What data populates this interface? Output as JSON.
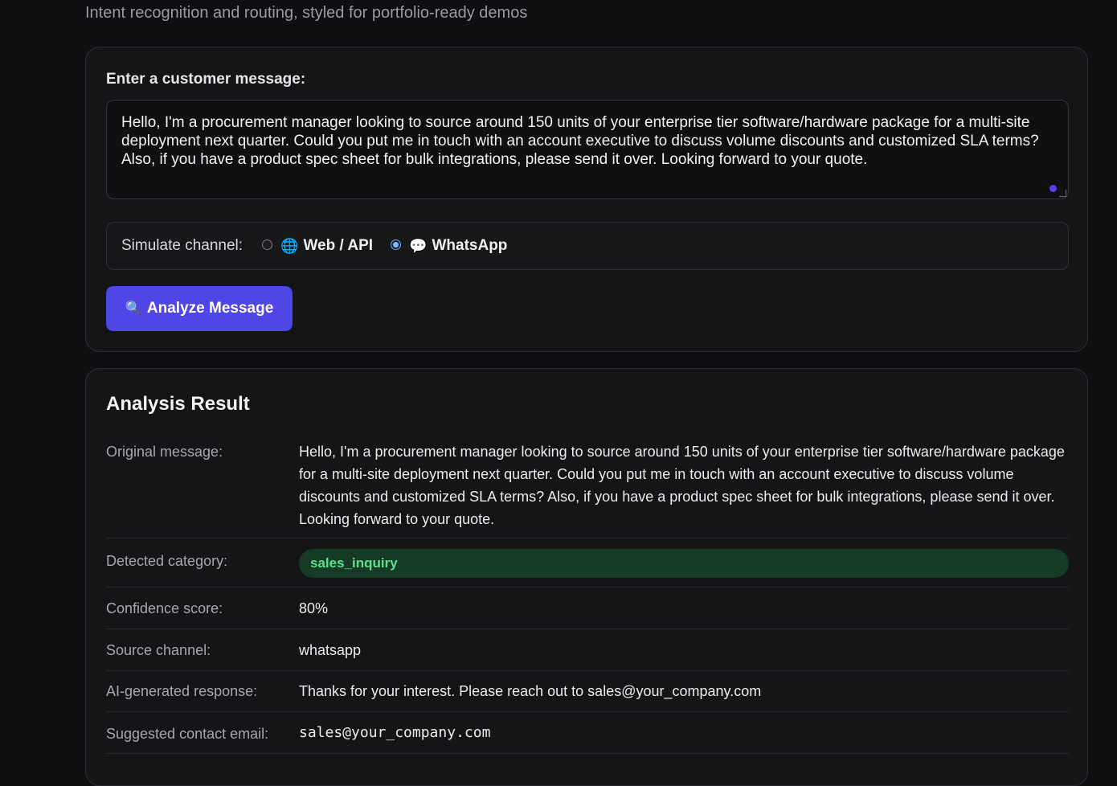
{
  "header": {
    "subtitle": "Intent recognition and routing, styled for portfolio-ready demos"
  },
  "input_card": {
    "prompt_label": "Enter a customer message:",
    "message_value": "Hello, I'm a procurement manager looking to source around 150 units of your enterprise tier software/hardware package for a multi-site deployment next quarter. Could you put me in touch with an account executive to discuss volume discounts and customized SLA terms? Also, if you have a product spec sheet for bulk integrations, please send it over. Looking forward to your quote.",
    "channel": {
      "label": "Simulate channel:",
      "options": [
        {
          "icon": "globe-icon",
          "glyph": "🌐",
          "label": "Web / API",
          "selected": false
        },
        {
          "icon": "speech-bubble-icon",
          "glyph": "💬",
          "label": "WhatsApp",
          "selected": true
        }
      ]
    },
    "analyze_button": {
      "icon": "magnifier-icon",
      "glyph": "🔍",
      "label": "Analyze Message"
    }
  },
  "result_card": {
    "title": "Analysis Result",
    "rows": {
      "original_message": {
        "key": "Original message:",
        "value": "Hello, I'm a procurement manager looking to source around 150 units of your enterprise tier software/hardware package for a multi-site deployment next quarter. Could you put me in touch with an account executive to discuss volume discounts and customized SLA terms? Also, if you have a product spec sheet for bulk integrations, please send it over. Looking forward to your quote."
      },
      "category": {
        "key": "Detected category:",
        "value": "sales_inquiry"
      },
      "confidence": {
        "key": "Confidence score:",
        "value": "80%"
      },
      "source_channel": {
        "key": "Source channel:",
        "value": "whatsapp"
      },
      "ai_response": {
        "key": "AI-generated response:",
        "value": "Thanks for your interest. Please reach out to sales@your_company.com"
      },
      "contact_email": {
        "key": "Suggested contact email:",
        "value": "sales@your_company.com"
      }
    }
  },
  "colors": {
    "background": "#0e0f11",
    "card": "#151518",
    "accent_button": "#4f46e5",
    "badge_bg": "#153a25",
    "badge_text": "#5ee08c"
  }
}
